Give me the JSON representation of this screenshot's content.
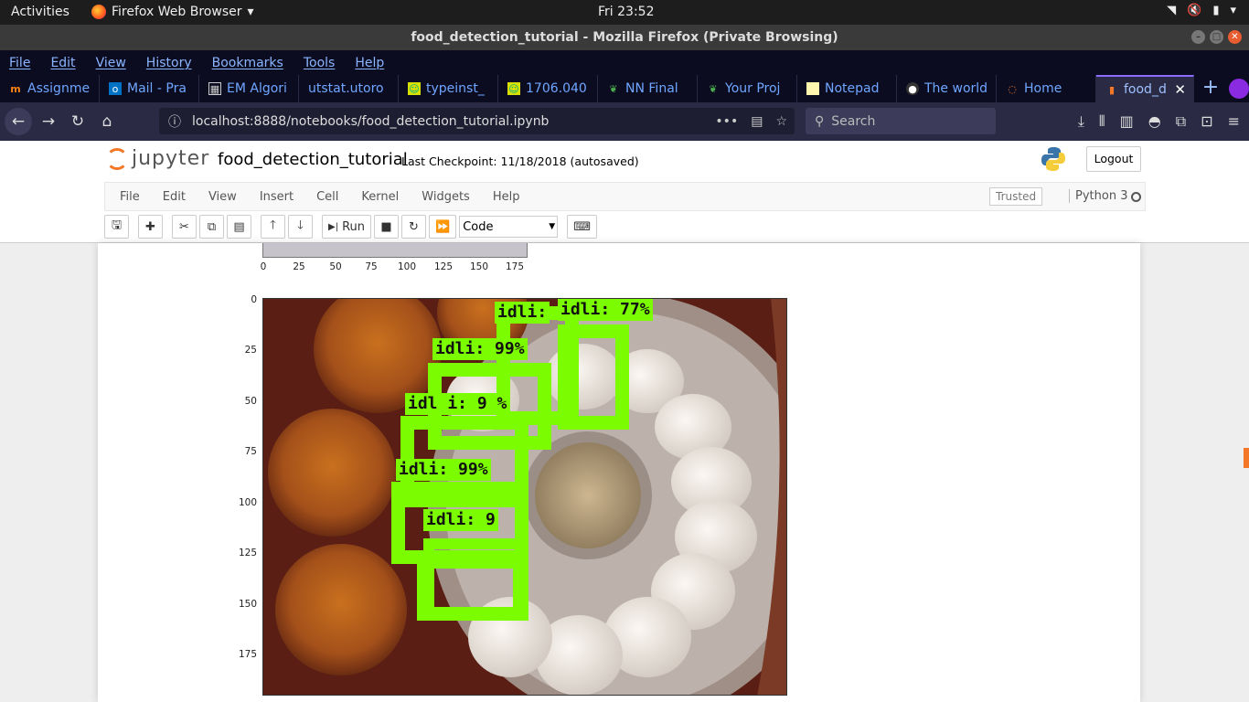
{
  "topbar": {
    "activities": "Activities",
    "app_name": "Firefox Web Browser",
    "clock": "Fri 23:52"
  },
  "window": {
    "title": "food_detection_tutorial - Mozilla Firefox (Private Browsing)"
  },
  "menubar": [
    "File",
    "Edit",
    "View",
    "History",
    "Bookmarks",
    "Tools",
    "Help"
  ],
  "tabs": [
    {
      "label": "Assignme",
      "icon": "moodle-icon"
    },
    {
      "label": "Mail - Pra",
      "icon": "outlook-icon"
    },
    {
      "label": "EM Algori",
      "icon": "calculator-icon"
    },
    {
      "label": "utstat.utoro",
      "icon": ""
    },
    {
      "label": "typeinst_",
      "icon": "smiley-icon"
    },
    {
      "label": "1706.040",
      "icon": "smiley-icon"
    },
    {
      "label": "NN Final",
      "icon": "leaf-icon"
    },
    {
      "label": "Your Proj",
      "icon": "leaf-icon"
    },
    {
      "label": "Notepad",
      "icon": "note-icon"
    },
    {
      "label": "The world",
      "icon": "github-icon"
    },
    {
      "label": "Home",
      "icon": "jupyter-icon"
    },
    {
      "label": "food_d",
      "icon": "book-icon",
      "active": true
    }
  ],
  "nav": {
    "url": "localhost:8888/notebooks/food_detection_tutorial.ipynb",
    "search_placeholder": "Search"
  },
  "jupyter": {
    "logo_text": "jupyter",
    "notebook_name": "food_detection_tutorial",
    "checkpoint": "Last Checkpoint: 11/18/2018   (autosaved)",
    "logout": "Logout",
    "menu": [
      "File",
      "Edit",
      "View",
      "Insert",
      "Cell",
      "Kernel",
      "Widgets",
      "Help"
    ],
    "trusted": "Trusted",
    "kernel": "Python 3",
    "run_label": "Run",
    "cell_type": "Code"
  },
  "figure1": {
    "x_ticks": [
      "0",
      "25",
      "50",
      "75",
      "100",
      "125",
      "150",
      "175"
    ]
  },
  "figure2": {
    "y_ticks": [
      "0",
      "25",
      "50",
      "75",
      "100",
      "125",
      "150",
      "175"
    ],
    "detections": [
      {
        "label": "idli:",
        "score": ""
      },
      {
        "label": "idli:",
        "score": "77%"
      },
      {
        "label": "idli:",
        "score": "99%"
      },
      {
        "label": "idl i:",
        "score": "9 %"
      },
      {
        "label": "idli:",
        "score": "99%"
      },
      {
        "label": "idli:",
        "score": "9"
      }
    ]
  },
  "colors": {
    "detection_box": "#7cfc00",
    "jupyter_orange": "#f37726"
  }
}
